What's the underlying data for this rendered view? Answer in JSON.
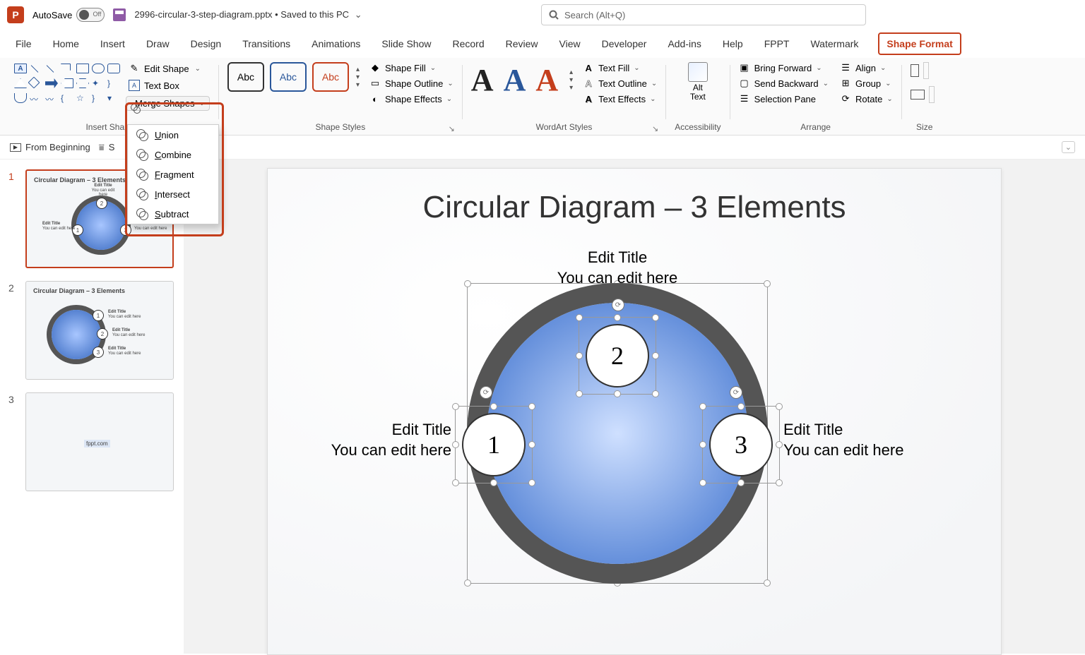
{
  "titlebar": {
    "autosave": "AutoSave",
    "toggle": "Off",
    "filename": "2996-circular-3-step-diagram.pptx • Saved to this PC",
    "search_placeholder": "Search (Alt+Q)"
  },
  "tabs": [
    "File",
    "Home",
    "Insert",
    "Draw",
    "Design",
    "Transitions",
    "Animations",
    "Slide Show",
    "Record",
    "Review",
    "View",
    "Developer",
    "Add-ins",
    "Help",
    "FPPT",
    "Watermark",
    "Shape Format"
  ],
  "active_tab": "Shape Format",
  "ribbon": {
    "insert_shapes_label": "Insert Shapes",
    "edit_shape": "Edit Shape",
    "text_box": "Text Box",
    "merge_shapes": "Merge Shapes",
    "shape_styles_label": "Shape Styles",
    "swatch_text": "Abc",
    "shape_fill": "Shape Fill",
    "shape_outline": "Shape Outline",
    "shape_effects": "Shape Effects",
    "wordart_label": "WordArt Styles",
    "text_fill": "Text Fill",
    "text_outline": "Text Outline",
    "text_effects": "Text Effects",
    "accessibility_label": "Accessibility",
    "alt_text": "Alt Text",
    "arrange_label": "Arrange",
    "bring_forward": "Bring Forward",
    "send_backward": "Send Backward",
    "selection_pane": "Selection Pane",
    "align": "Align",
    "group": "Group",
    "rotate": "Rotate",
    "size_label": "Size"
  },
  "quick": {
    "from_beginning": "From Beginning"
  },
  "merge_menu": {
    "union": "nion",
    "combine": "ombine",
    "fragment": "ragment",
    "intersect": "ntersect",
    "subtract": "ubtract"
  },
  "thumbs": {
    "t1_title": "Circular Diagram – 3 Elements",
    "t2_title": "Circular Diagram – 3 Elements",
    "edit_title": "Edit Title",
    "edit_here": "You can edit here",
    "t3_text": "fppt.com"
  },
  "slide": {
    "title": "Circular Diagram – 3 Elements",
    "n1": "1",
    "n2": "2",
    "n3": "3",
    "l_title": "Edit Title",
    "l_body": "You can edit here"
  }
}
